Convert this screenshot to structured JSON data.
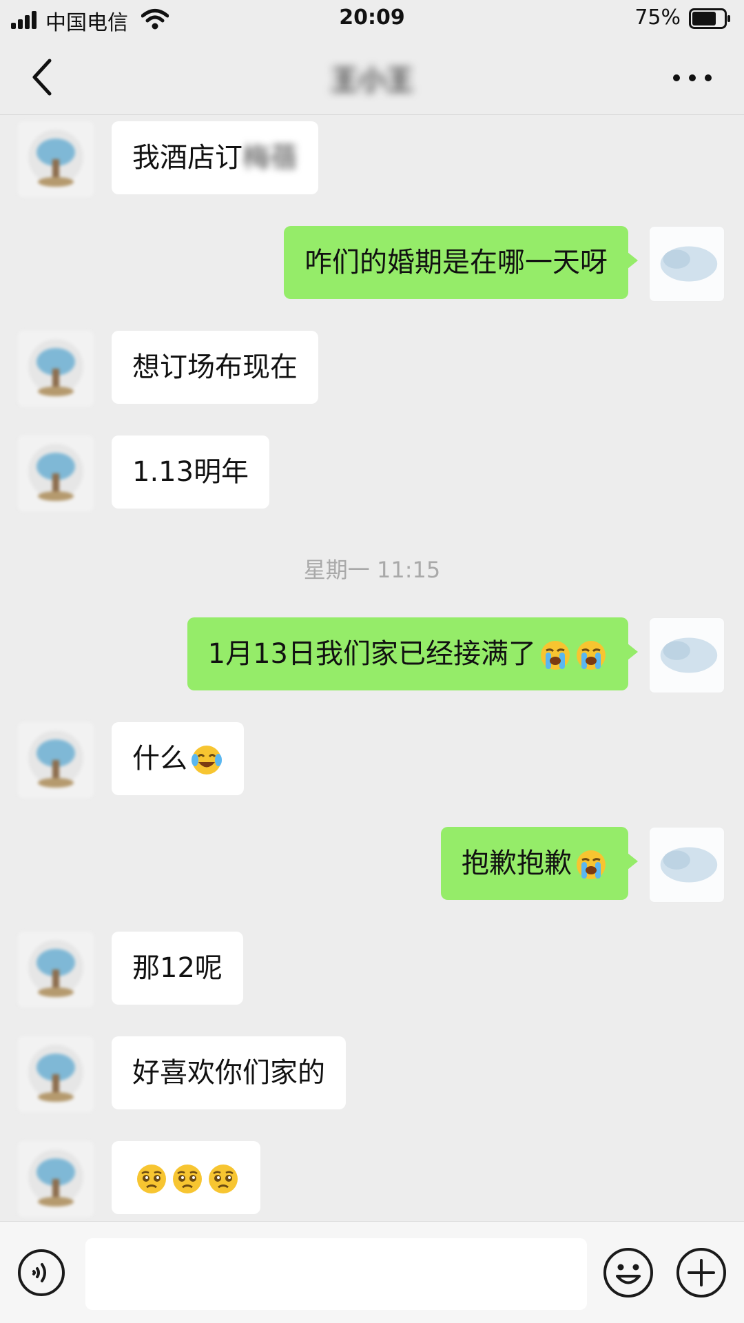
{
  "status_bar": {
    "carrier": "中国电信",
    "time": "20:09",
    "battery_percent": "75%",
    "battery_level": 0.75
  },
  "nav": {
    "title": "王小王",
    "back_icon": "chevron-left-icon",
    "more_icon": "ellipsis-icon"
  },
  "messages": [
    {
      "side": "in",
      "text": "我酒店订",
      "blurred_suffix": "梅蓓"
    },
    {
      "side": "out",
      "text": "咋们的婚期是在哪一天呀"
    },
    {
      "side": "in",
      "text": "想订场布现在"
    },
    {
      "side": "in",
      "text": "1.13明年"
    },
    {
      "side": "out",
      "text": "1月13日我们家已经接满了",
      "emoji": [
        "loudly-crying-face",
        "loudly-crying-face"
      ]
    },
    {
      "side": "in",
      "text": "什么",
      "emoji": [
        "face-with-tears-of-joy"
      ]
    },
    {
      "side": "out",
      "text": "抱歉抱歉",
      "emoji": [
        "loudly-crying-face"
      ]
    },
    {
      "side": "in",
      "text": "那12呢"
    },
    {
      "side": "in",
      "text": "好喜欢你们家的"
    },
    {
      "side": "in",
      "text": "",
      "emoji": [
        "pleading-face",
        "pleading-face",
        "pleading-face"
      ]
    }
  ],
  "timestamp": "星期一 11:15",
  "input_bar": {
    "value": "",
    "voice_icon": "voice-icon",
    "emoji_icon": "emoji-icon",
    "plus_icon": "plus-icon"
  },
  "colors": {
    "chat_bg": "#ededed",
    "outgoing_bubble": "#95ec69",
    "incoming_bubble": "#ffffff",
    "timestamp_text": "#a9a9a9"
  }
}
